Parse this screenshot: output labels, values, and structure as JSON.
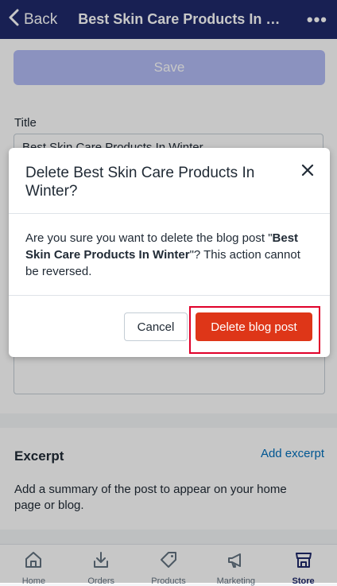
{
  "nav": {
    "back_label": "Back",
    "title": "Best Skin Care Products In Wi...",
    "more_label": "•••"
  },
  "save_label": "Save",
  "title_field": {
    "label": "Title",
    "value": "Best Skin Care Products In Winter"
  },
  "excerpt": {
    "title": "Excerpt",
    "add_label": "Add excerpt",
    "description": "Add a summary of the post to appear on your home page or blog."
  },
  "modal": {
    "title": "Delete Best Skin Care Products In Winter?",
    "body_prefix": "Are you sure you want to delete the blog post \"",
    "body_bold": "Best Skin Care Products In Winter",
    "body_suffix": "\"? This action cannot be reversed.",
    "cancel_label": "Cancel",
    "delete_label": "Delete blog post"
  },
  "tabs": [
    {
      "label": "Home",
      "icon": "home-icon"
    },
    {
      "label": "Orders",
      "icon": "orders-icon"
    },
    {
      "label": "Products",
      "icon": "tag-icon"
    },
    {
      "label": "Marketing",
      "icon": "megaphone-icon"
    },
    {
      "label": "Store",
      "icon": "store-icon",
      "active": true
    }
  ],
  "colors": {
    "nav_bg": "#1f2a6b",
    "save_disabled": "#b3bcf5",
    "delete": "#de3618",
    "highlight": "#e0002a",
    "link": "#006fbb"
  }
}
